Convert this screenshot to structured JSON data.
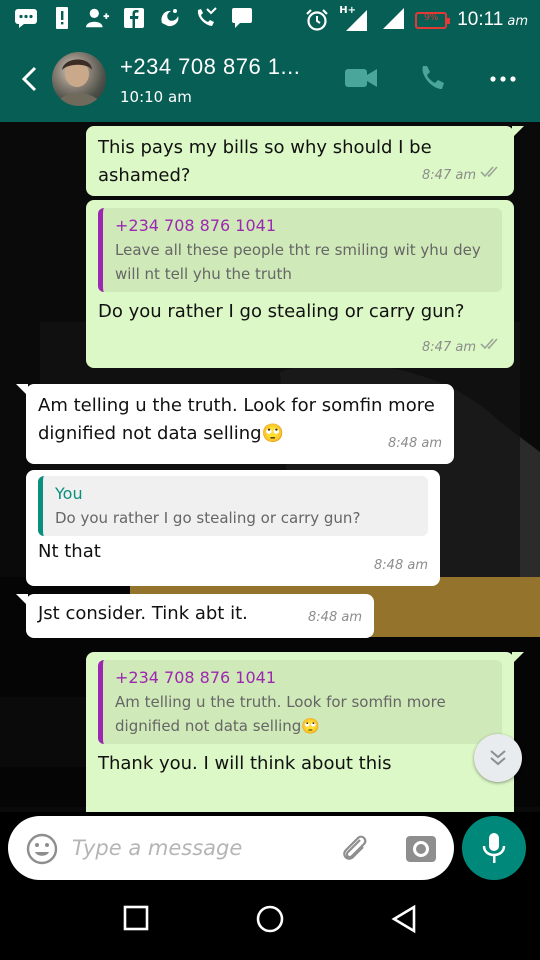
{
  "status_bar": {
    "time": "10:11",
    "ampm": "am",
    "network": "H+",
    "battery_text": "9%",
    "icons": [
      "message-icon",
      "alert-icon",
      "add-person-icon",
      "facebook-icon",
      "uc-browser-icon",
      "missed-call-icon",
      "chat-icon",
      "alarm-icon",
      "signal-icon",
      "signal-icon",
      "battery-icon"
    ]
  },
  "header": {
    "contact": "+234 708 876 1...",
    "last_seen": "10:10 am",
    "icons": [
      "back-arrow-icon",
      "video-call-icon",
      "phone-icon",
      "more-options-icon"
    ]
  },
  "messages": [
    {
      "dir": "out",
      "text": "This pays my bills so why should I be ashamed?",
      "time": "8:47 am",
      "status": "read"
    },
    {
      "dir": "out",
      "quote_author": "+234 708 876 1041",
      "quote_text": "Leave all these people tht  re smiling wit yhu dey will nt tell yhu the truth",
      "text": "Do you rather I go stealing or carry gun?",
      "time": "8:47 am",
      "status": "read"
    },
    {
      "dir": "in",
      "text": "Am telling u the truth. Look for somfin more dignified not data selling",
      "emoji": "🙄",
      "time": "8:48 am"
    },
    {
      "dir": "in",
      "quote_author": "You",
      "quote_text": "Do you rather I go stealing or carry gun?",
      "text": "Nt that",
      "time": "8:48 am"
    },
    {
      "dir": "in",
      "text": "Jst consider. Tink abt it.",
      "time": "8:48 am"
    },
    {
      "dir": "out",
      "quote_author": "+234 708 876 1041",
      "quote_text": "Am telling u the truth. Look for somfin more dignified not data selling",
      "quote_emoji": "🙄",
      "text": "Thank you. I will think about this"
    }
  ],
  "input": {
    "placeholder": "Type a message",
    "icons": [
      "emoji-icon",
      "attach-icon",
      "camera-icon",
      "mic-icon"
    ]
  },
  "nav_icons": [
    "recent-apps-icon",
    "home-icon",
    "back-icon"
  ],
  "colors": {
    "header": "#075e54",
    "outgoing_bubble": "#dcf8c6",
    "incoming_bubble": "#ffffff",
    "quote_bar_other": "#9c27b0",
    "quote_bar_you": "#0a8f7f",
    "mic_button": "#00897b"
  }
}
